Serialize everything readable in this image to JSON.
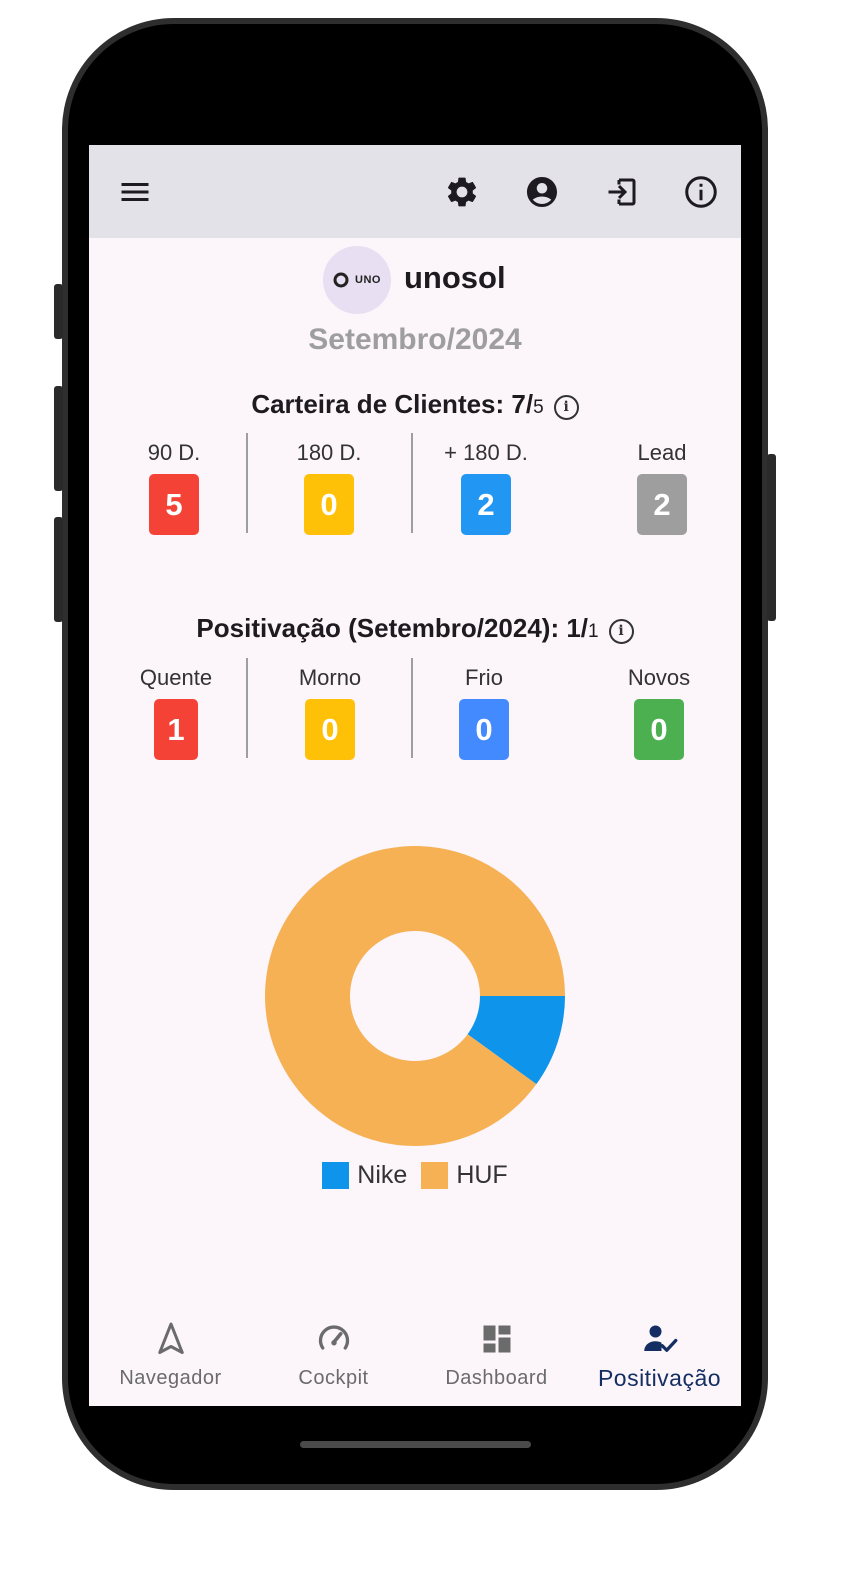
{
  "topbar": {
    "icons": [
      "menu-icon",
      "gear-icon",
      "account-icon",
      "logout-icon",
      "info-icon"
    ]
  },
  "header": {
    "logo_text": "UNO",
    "brand_name": "unosol",
    "month": "Setembro/2024"
  },
  "carteira": {
    "title_main": "Carteira de Clientes: 7/",
    "title_small": "5",
    "info_glyph": "i",
    "stats": [
      {
        "label": "90 D.",
        "value": "5",
        "color": "#f44336"
      },
      {
        "label": "180 D.",
        "value": "0",
        "color": "#ffc107"
      },
      {
        "label": "+ 180 D.",
        "value": "2",
        "color": "#2196f3"
      },
      {
        "label": "Lead",
        "value": "2",
        "color": "#9e9e9e"
      }
    ]
  },
  "positivacao": {
    "title_main": "Positivação (Setembro/2024): 1/",
    "title_small": "1",
    "info_glyph": "i",
    "stats": [
      {
        "label": "Quente",
        "value": "1",
        "color": "#f44336"
      },
      {
        "label": "Morno",
        "value": "0",
        "color": "#ffc107"
      },
      {
        "label": "Frio",
        "value": "0",
        "color": "#448aff"
      },
      {
        "label": "Novos",
        "value": "0",
        "color": "#4caf50"
      }
    ]
  },
  "chart_data": {
    "type": "pie",
    "donut": true,
    "categories": [
      "Nike",
      "HUF"
    ],
    "values": [
      1,
      9
    ],
    "colors": [
      "#0e94eb",
      "#f6b155"
    ],
    "legend": "bottom"
  },
  "bottom_nav": {
    "items": [
      {
        "label": "Navegador",
        "icon": "navigation-icon",
        "active": false
      },
      {
        "label": "Cockpit",
        "icon": "speedometer-icon",
        "active": false
      },
      {
        "label": "Dashboard",
        "icon": "dashboard-icon",
        "active": false
      },
      {
        "label": "Positivação",
        "icon": "person-check-icon",
        "active": true
      }
    ],
    "active_color": "#142e63"
  }
}
